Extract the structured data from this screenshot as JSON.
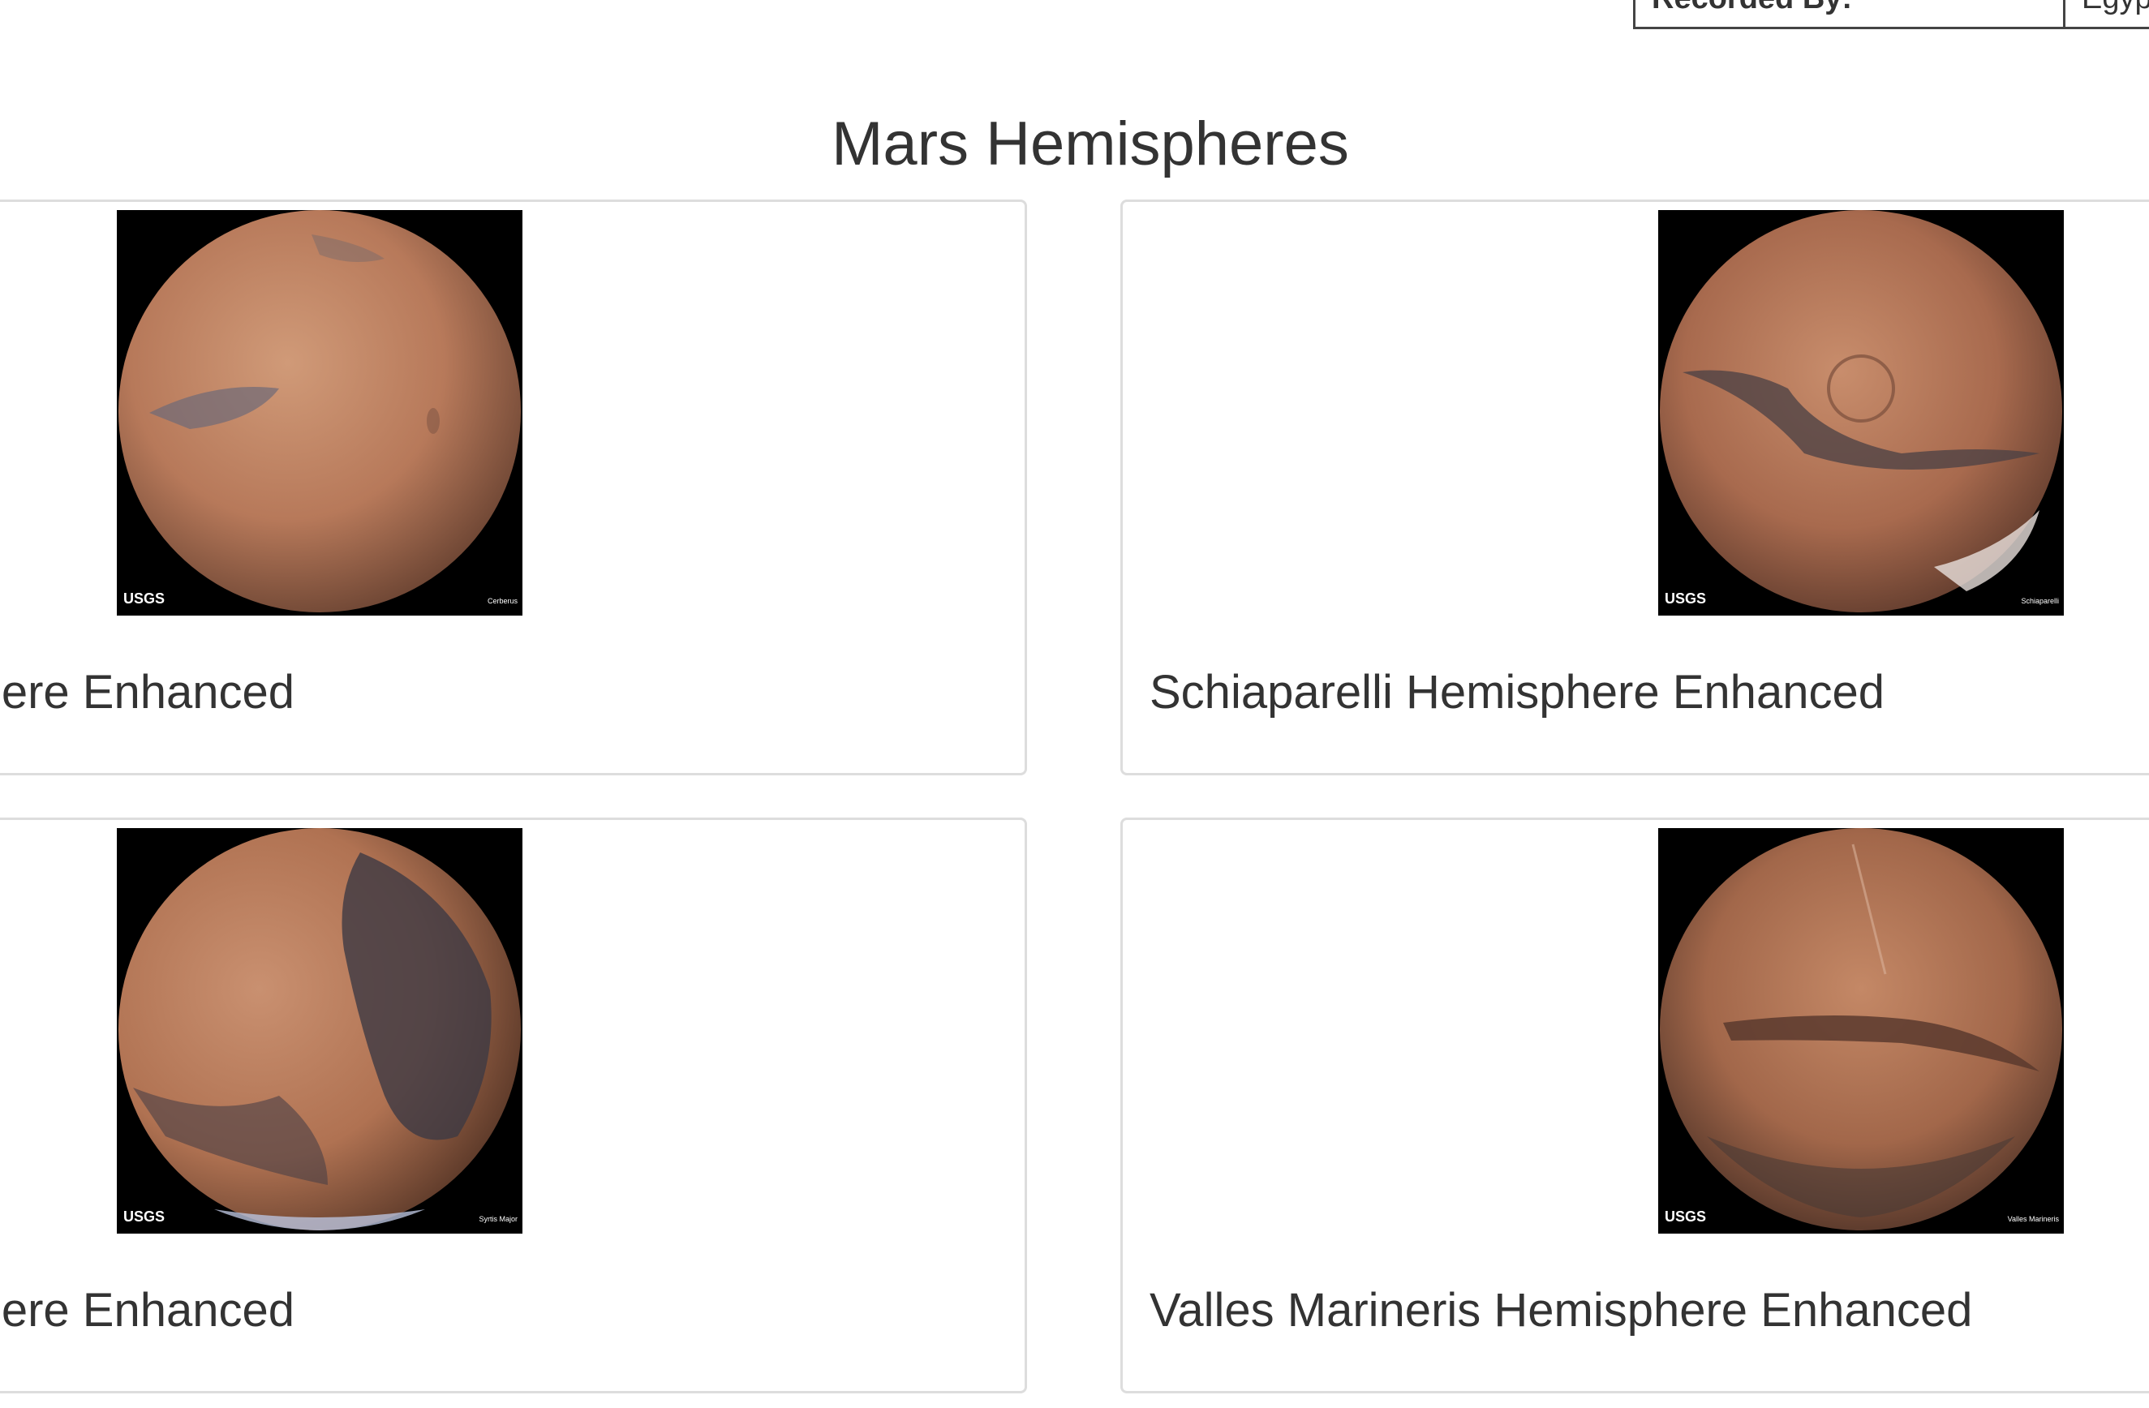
{
  "facts_table": {
    "row_label": "Recorded By:",
    "row_value": "Egyp"
  },
  "section_title": "Mars Hemispheres",
  "hemispheres": [
    {
      "title": "Cerberus Hemisphere Enhanced",
      "image_label": "Cerberus",
      "logo": "USGS"
    },
    {
      "title": "Schiaparelli Hemisphere Enhanced",
      "image_label": "Schiaparelli",
      "logo": "USGS"
    },
    {
      "title": "Syrtis Major Hemisphere Enhanced",
      "image_label": "Syrtis Major",
      "logo": "USGS"
    },
    {
      "title": "Valles Marineris Hemisphere Enhanced",
      "image_label": "Valles Marineris",
      "logo": "USGS"
    }
  ],
  "colors": {
    "mars_base": "#b7795a",
    "mars_dark": "#3e3a3f",
    "card_border": "#dddddd",
    "text": "#333333"
  }
}
